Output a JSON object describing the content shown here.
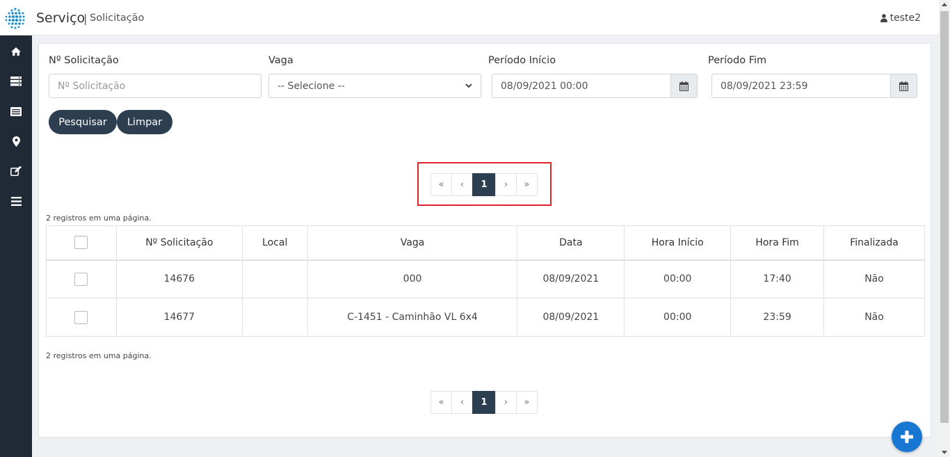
{
  "header": {
    "title": "Serviço",
    "separator": "|",
    "subtitle": "Solicitação",
    "user": "teste2"
  },
  "sidebar": {
    "icons": [
      "home-icon",
      "server-icon",
      "list-icon",
      "map-marker-icon",
      "edit-icon",
      "menu-icon"
    ]
  },
  "filters": {
    "solicitacao": {
      "label": "Nº Solicitação",
      "placeholder": "Nº Solicitação",
      "value": ""
    },
    "vaga": {
      "label": "Vaga",
      "selected": "-- Selecione --"
    },
    "inicio": {
      "label": "Período Início",
      "value": "08/09/2021 00:00"
    },
    "fim": {
      "label": "Período Fim",
      "value": "08/09/2021 23:59"
    }
  },
  "buttons": {
    "search": "Pesquisar",
    "clear": "Limpar"
  },
  "pagination": {
    "first": "«",
    "prev": "‹",
    "current": "1",
    "next": "›",
    "last": "»"
  },
  "records_info": "2 registros em uma página.",
  "table": {
    "headers": [
      "Nº Solicitação",
      "Local",
      "Vaga",
      "Data",
      "Hora Início",
      "Hora Fim",
      "Finalizada"
    ],
    "rows": [
      {
        "numero": "14676",
        "local": "",
        "vaga": "000",
        "data": "08/09/2021",
        "hora_inicio": "00:00",
        "hora_fim": "17:40",
        "finalizada": "Não"
      },
      {
        "numero": "14677",
        "local": "",
        "vaga": "C-1451 - Caminhão VL 6x4",
        "data": "08/09/2021",
        "hora_inicio": "00:00",
        "hora_fim": "23:59",
        "finalizada": "Não"
      }
    ]
  },
  "colors": {
    "sidebar": "#1f2a36",
    "primary_button": "#2d3e50",
    "fab": "#1877d2",
    "highlight": "#e0242b"
  }
}
